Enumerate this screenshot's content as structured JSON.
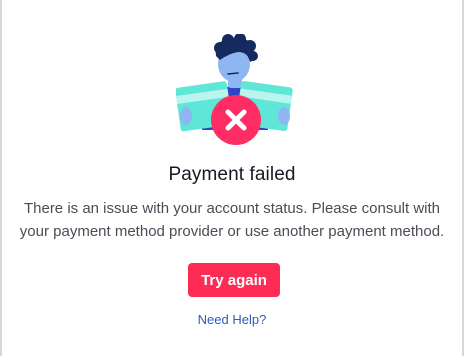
{
  "dialog": {
    "illustration_icon": "payment-failed-illustration",
    "error_icon": "x-circle-icon",
    "title": "Payment failed",
    "message": "There is an issue with your account status. Please consult with your payment method provider or use another payment method.",
    "primary_button_label": "Try again",
    "help_link_label": "Need Help?"
  },
  "colors": {
    "accent": "#fe2c55",
    "link": "#2b5db9",
    "title": "#161823",
    "body_text": "#4b4c55"
  }
}
